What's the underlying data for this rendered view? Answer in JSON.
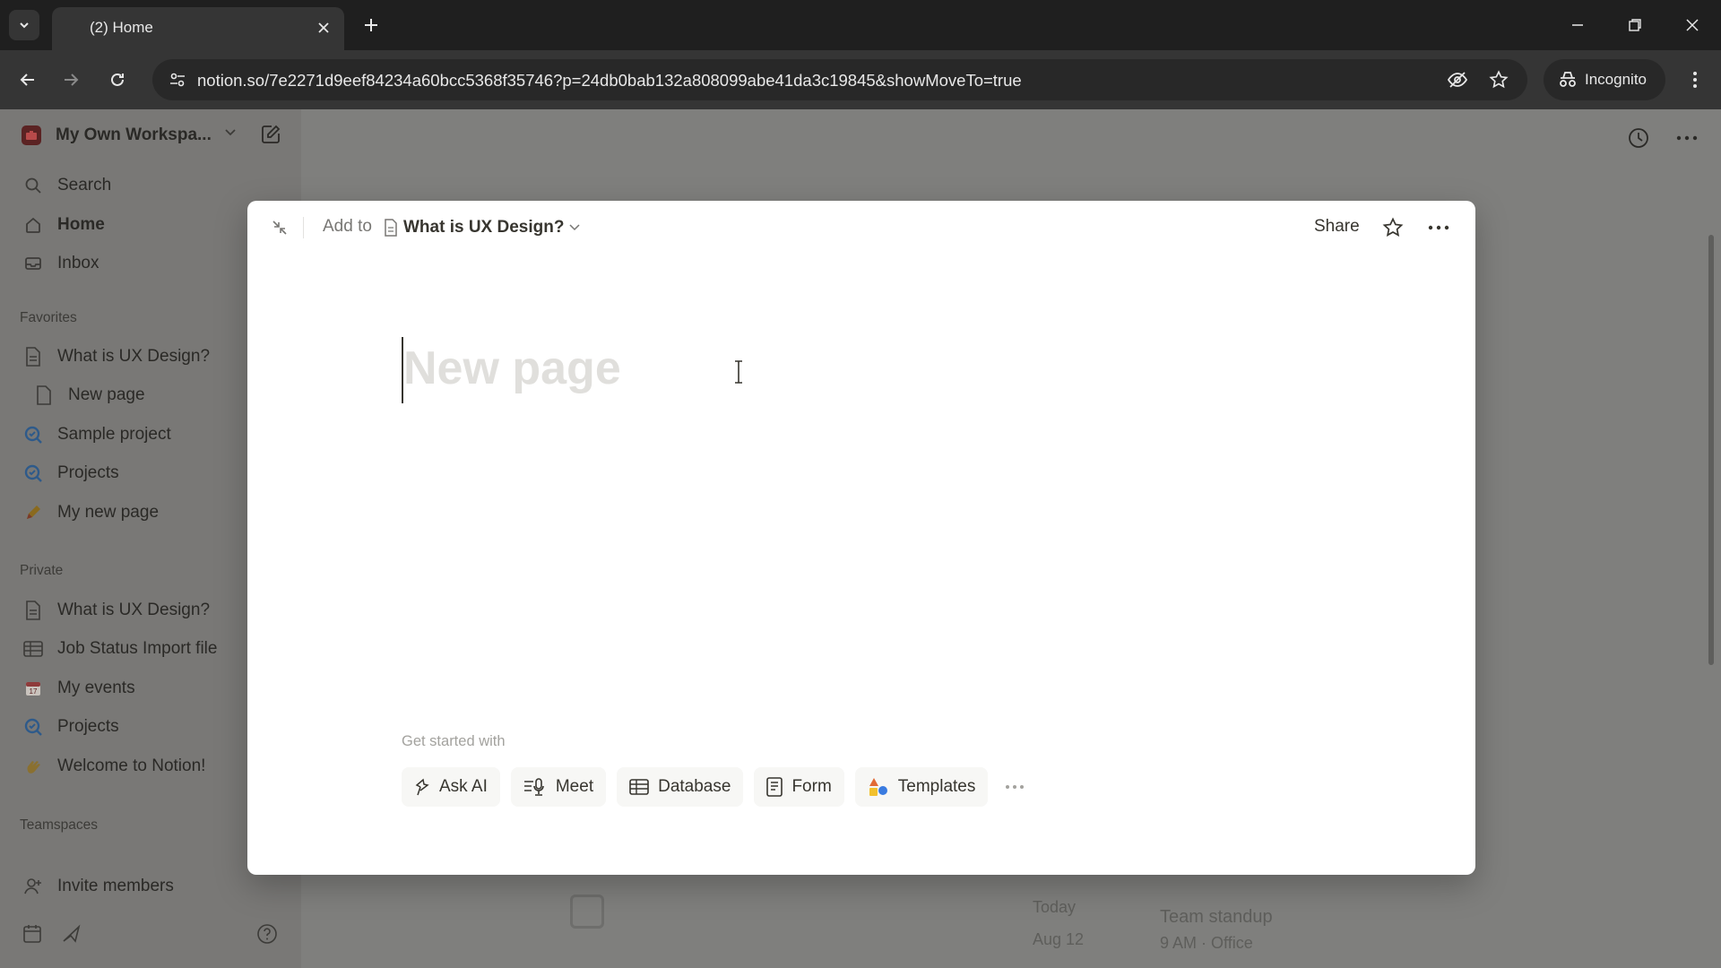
{
  "browser": {
    "tab_title": "(2) Home",
    "url": "notion.so/7e2271d9eef84234a60bcc5368f35746?p=24db0bab132a808099abe41da3c19845&showMoveTo=true",
    "profile_label": "Incognito"
  },
  "workspace": {
    "name": "My Own Workspa..."
  },
  "sidebar": {
    "nav": [
      {
        "label": "Search",
        "icon": "search-icon"
      },
      {
        "label": "Home",
        "icon": "home-icon"
      },
      {
        "label": "Inbox",
        "icon": "inbox-icon"
      }
    ],
    "favorites_label": "Favorites",
    "favorites": [
      {
        "label": "What is UX Design?",
        "icon": "page-icon"
      },
      {
        "label": "New page",
        "icon": "page-icon"
      },
      {
        "label": "Sample project",
        "icon": "project-icon"
      },
      {
        "label": "Projects",
        "icon": "project-icon"
      },
      {
        "label": "My new page",
        "icon": "pencil-emoji-icon"
      }
    ],
    "private_label": "Private",
    "private": [
      {
        "label": "What is UX Design?",
        "icon": "page-icon"
      },
      {
        "label": "Job Status Import file",
        "icon": "table-icon"
      },
      {
        "label": "My events",
        "icon": "calendar-emoji-icon"
      },
      {
        "label": "Projects",
        "icon": "project-icon"
      },
      {
        "label": "Welcome to Notion!",
        "icon": "wave-emoji-icon"
      }
    ],
    "teamspaces_label": "Teamspaces",
    "invite_label": "Invite members"
  },
  "background_content": {
    "date_day": "Today",
    "date": "Aug 12",
    "event_title": "Team standup",
    "event_detail": "9 AM · Office"
  },
  "modal": {
    "add_to_label": "Add to",
    "parent_page": "What is UX Design?",
    "share_label": "Share",
    "title_placeholder": "New page",
    "get_started_label": "Get started with",
    "chips": [
      {
        "label": "Ask AI",
        "icon": "ai-icon"
      },
      {
        "label": "Meet",
        "icon": "meet-icon"
      },
      {
        "label": "Database",
        "icon": "database-icon"
      },
      {
        "label": "Form",
        "icon": "form-icon"
      },
      {
        "label": "Templates",
        "icon": "templates-icon"
      }
    ]
  },
  "colors": {
    "chrome_dark": "#1f1f1f",
    "chrome_toolbar": "#353535",
    "overlay_dim": "#7c7c7a",
    "modal_bg": "#ffffff",
    "text_primary": "#37352f",
    "text_secondary": "#787774",
    "placeholder": "#e0dfdc"
  }
}
